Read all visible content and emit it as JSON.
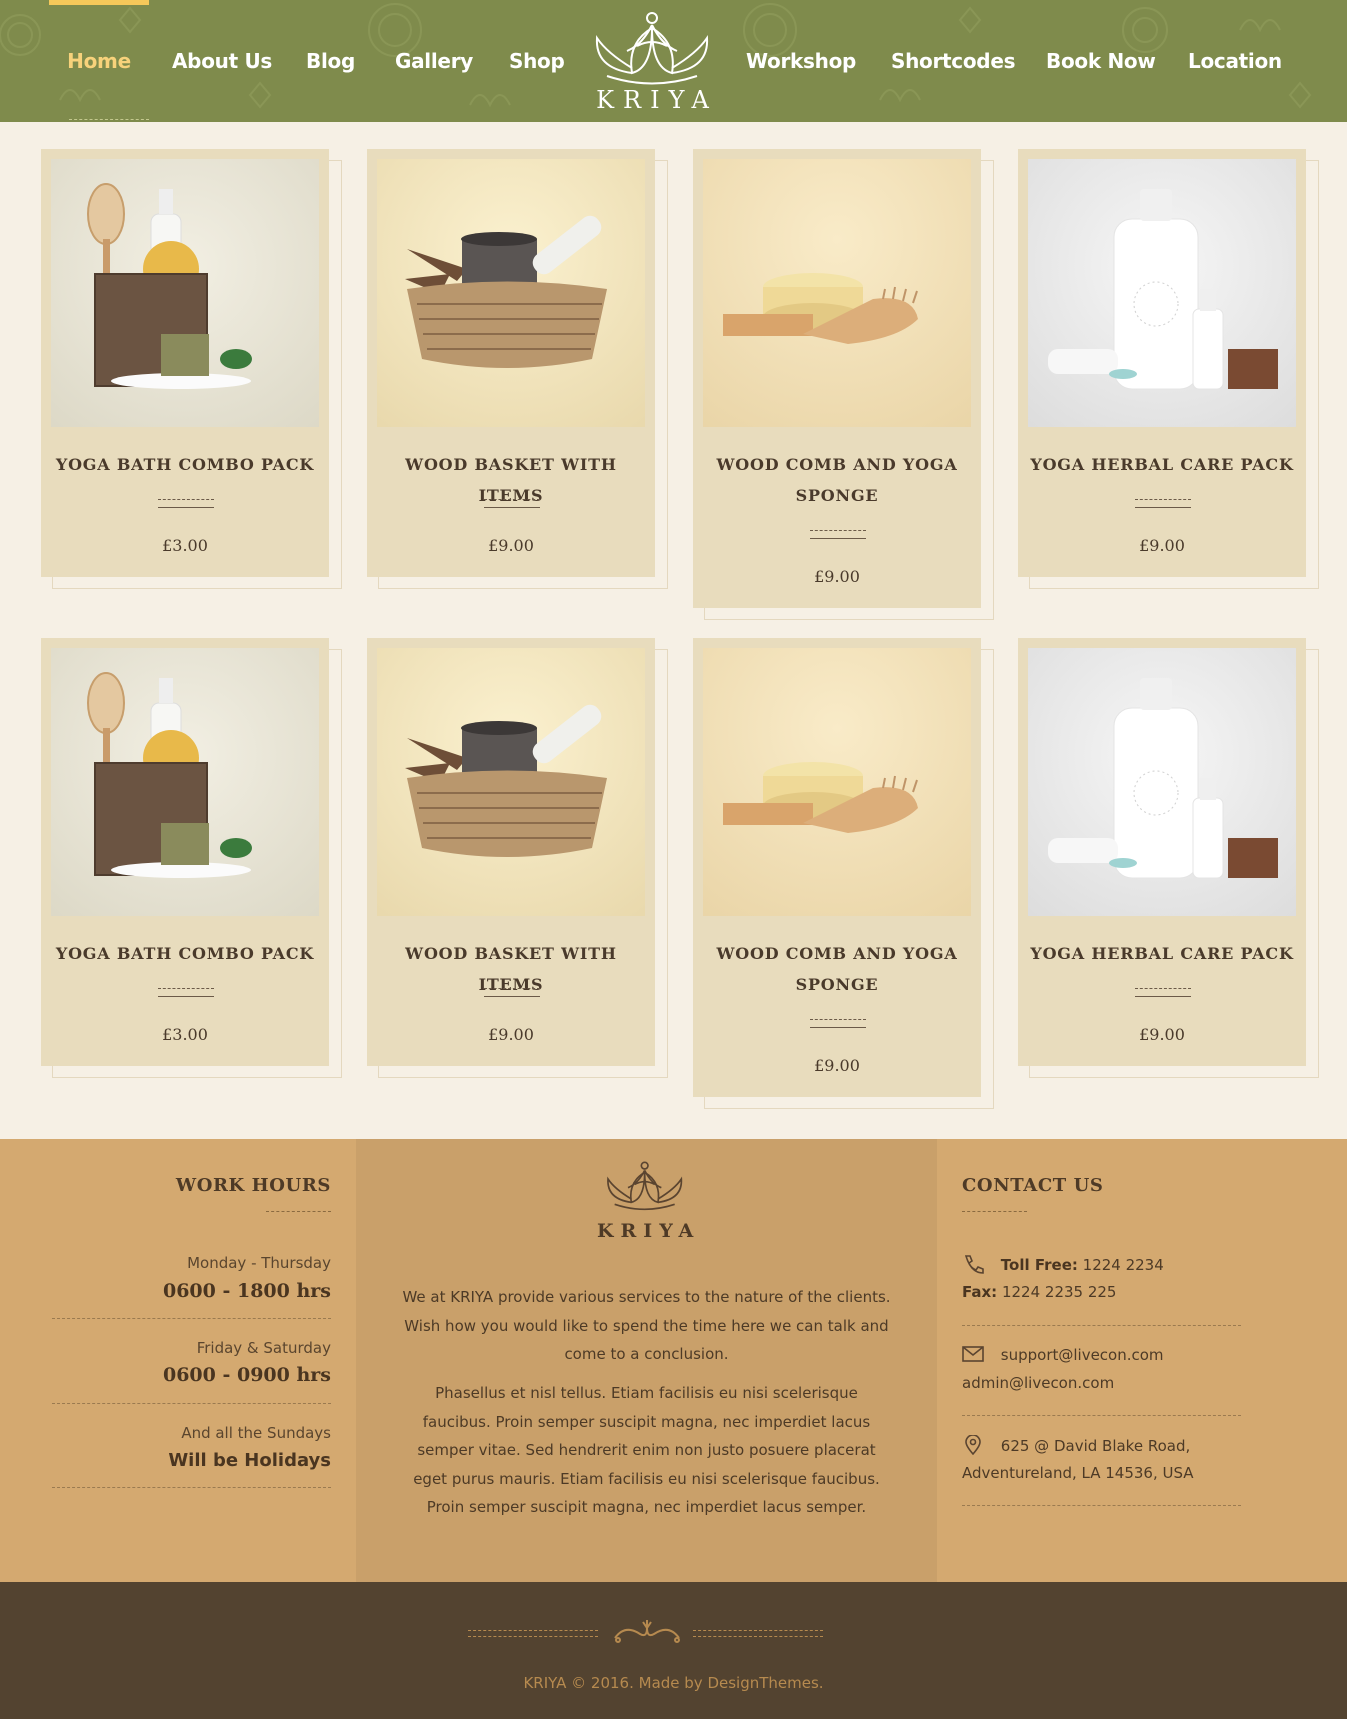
{
  "brand": {
    "name": "KRIYA"
  },
  "colors": {
    "header_bg": "#7f8b4c",
    "active_nav": "#f7d27b",
    "card_bg": "#e8dcbd",
    "footer_bg": "#d4a970",
    "bottom_bar": "#534330"
  },
  "nav": {
    "items": [
      {
        "label": "Home",
        "active": true
      },
      {
        "label": "About Us"
      },
      {
        "label": "Blog"
      },
      {
        "label": "Gallery"
      },
      {
        "label": "Shop"
      },
      {
        "label": "Workshop"
      },
      {
        "label": "Shortcodes"
      },
      {
        "label": "Book Now"
      },
      {
        "label": "Location"
      }
    ]
  },
  "products": [
    {
      "title": "Yoga Bath Combo Pack",
      "price": "£3.00",
      "image": "yoga-bath-combo"
    },
    {
      "title": "Wood Basket with Items",
      "price": "£9.00",
      "image": "wood-basket"
    },
    {
      "title": "Wood Comb and Yoga Sponge",
      "price": "£9.00",
      "image": "comb-sponge"
    },
    {
      "title": "Yoga Herbal Care Pack",
      "price": "£9.00",
      "image": "herbal-care"
    },
    {
      "title": "Yoga Bath Combo Pack",
      "price": "£3.00",
      "image": "yoga-bath-combo"
    },
    {
      "title": "Wood Basket with Items",
      "price": "£9.00",
      "image": "wood-basket"
    },
    {
      "title": "Wood Comb and Yoga Sponge",
      "price": "£9.00",
      "image": "comb-sponge"
    },
    {
      "title": "Yoga Herbal Care Pack",
      "price": "£9.00",
      "image": "herbal-care"
    }
  ],
  "footer": {
    "work_hours": {
      "heading": "WORK HOURS",
      "rows": [
        {
          "label": "Monday - Thursday",
          "value": "0600 - 1800 hrs"
        },
        {
          "label": "Friday & Saturday",
          "value": "0600 - 0900 hrs"
        },
        {
          "label": "And all the Sundays",
          "value": "Will be Holidays"
        }
      ]
    },
    "about": {
      "paragraph1": "We at KRIYA provide various services to the nature of the clients. Wish how you would like to spend the time here we can talk and come to a conclusion.",
      "paragraph2": "Phasellus et nisl tellus. Etiam facilisis eu nisi scelerisque faucibus. Proin semper suscipit magna, nec imperdiet lacus semper vitae. Sed hendrerit enim non justo posuere placerat eget purus mauris. Etiam facilisis eu nisi scelerisque faucibus. Proin semper suscipit magna, nec imperdiet lacus semper."
    },
    "contact": {
      "heading": "CONTACT US",
      "toll_free_label": "Toll Free:",
      "toll_free": "1224 2234",
      "fax_label": "Fax:",
      "fax": "1224 2235 225",
      "email1": "support@livecon.com",
      "email2": "admin@livecon.com",
      "address1": "625 @ David Blake Road,",
      "address2": "Adventureland, LA 14536, USA"
    },
    "copyright": "KRIYA © 2016. Made by DesignThemes."
  }
}
